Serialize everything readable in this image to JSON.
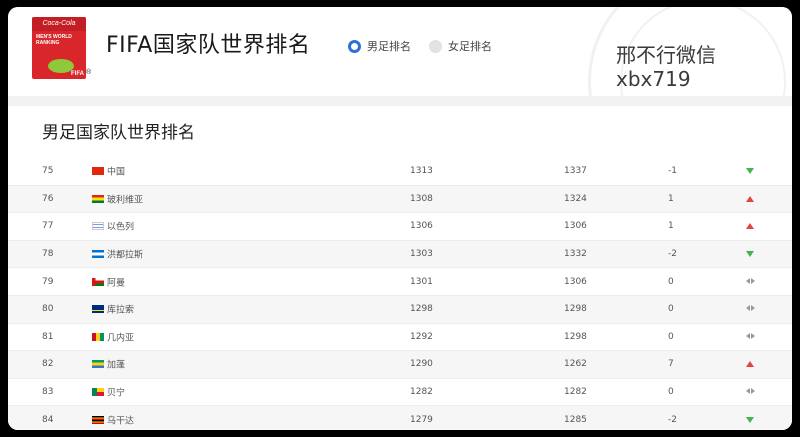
{
  "header": {
    "logo_text_top": "Coca-Cola",
    "logo_text_main": "MEN'S WORLD RANKING",
    "logo_fifa": "FIFA",
    "title": "FIFA国家队世界排名",
    "watermark_line1": "邢不行微信",
    "watermark_line2": "xbx719"
  },
  "tabs": [
    {
      "label": "男足排名",
      "selected": true
    },
    {
      "label": "女足排名",
      "selected": false
    }
  ],
  "section_title": "男足国家队世界排名",
  "rows": [
    {
      "rank": "75",
      "flag": "china-flag-icon",
      "team": "中国",
      "points": "1313",
      "previous": "1337",
      "change": "-1",
      "trend": "down"
    },
    {
      "rank": "76",
      "flag": "bolivia-flag-icon",
      "team": "玻利维亚",
      "points": "1308",
      "previous": "1324",
      "change": "1",
      "trend": "up"
    },
    {
      "rank": "77",
      "flag": "israel-flag-icon",
      "team": "以色列",
      "points": "1306",
      "previous": "1306",
      "change": "1",
      "trend": "up"
    },
    {
      "rank": "78",
      "flag": "honduras-flag-icon",
      "team": "洪都拉斯",
      "points": "1303",
      "previous": "1332",
      "change": "-2",
      "trend": "down"
    },
    {
      "rank": "79",
      "flag": "oman-flag-icon",
      "team": "阿曼",
      "points": "1301",
      "previous": "1306",
      "change": "0",
      "trend": "same"
    },
    {
      "rank": "80",
      "flag": "curacao-flag-icon",
      "team": "库拉索",
      "points": "1298",
      "previous": "1298",
      "change": "0",
      "trend": "same"
    },
    {
      "rank": "81",
      "flag": "guinea-flag-icon",
      "team": "几内亚",
      "points": "1292",
      "previous": "1298",
      "change": "0",
      "trend": "same"
    },
    {
      "rank": "82",
      "flag": "gabon-flag-icon",
      "team": "加蓬",
      "points": "1290",
      "previous": "1262",
      "change": "7",
      "trend": "up"
    },
    {
      "rank": "83",
      "flag": "benin-flag-icon",
      "team": "贝宁",
      "points": "1282",
      "previous": "1282",
      "change": "0",
      "trend": "same"
    },
    {
      "rank": "84",
      "flag": "uganda-flag-icon",
      "team": "乌干达",
      "points": "1279",
      "previous": "1285",
      "change": "-2",
      "trend": "down"
    }
  ],
  "colors": {
    "up": "#e0473d",
    "down": "#43b54a",
    "same": "#999999",
    "radio_active": "#2f6fd8"
  }
}
